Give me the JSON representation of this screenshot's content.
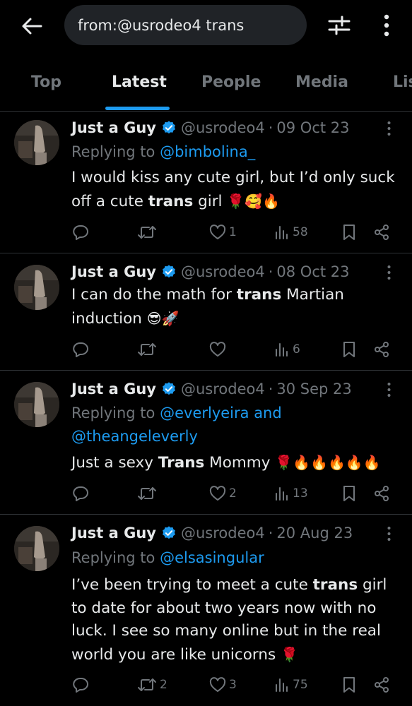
{
  "search": {
    "query": "from:@usrodeo4 trans"
  },
  "tabs": [
    "Top",
    "Latest",
    "People",
    "Media",
    "Lis"
  ],
  "accent": "#1d9bf0",
  "icons": {
    "back": "arrow-left-icon",
    "filter": "sliders-icon",
    "more": "more-vertical-icon",
    "reply": "reply-icon",
    "retweet": "retweet-icon",
    "like": "heart-icon",
    "views": "views-icon",
    "bookmark": "bookmark-icon",
    "share": "share-icon"
  },
  "tweets": [
    {
      "name": "Just a Guy",
      "handle": "@usrodeo4",
      "sep": "·",
      "date": "09 Oct 23",
      "replying_label": "Replying to",
      "replying_to": "@bimbolina_",
      "text_parts": [
        "I would kiss any cute girl, but I’d only suck off a cute ",
        "trans",
        " girl ",
        "🌹🥰🔥"
      ],
      "replies": "",
      "retweets": "",
      "likes": "1",
      "views": "58"
    },
    {
      "name": "Just a Guy",
      "handle": "@usrodeo4",
      "sep": "·",
      "date": "08 Oct 23",
      "text_parts": [
        "I can do the math for ",
        "trans",
        " Martian induction ",
        "😎🚀"
      ],
      "replies": "",
      "retweets": "",
      "likes": "",
      "views": "6"
    },
    {
      "name": "Just a Guy",
      "handle": "@usrodeo4",
      "sep": "·",
      "date": "30 Sep 23",
      "replying_label": "Replying to",
      "replying_to": "@everlyeira and",
      "replying_to_2": "@theangeleverly",
      "text_parts": [
        "Just a sexy ",
        "Trans",
        " Mommy ",
        "🌹🔥🔥🔥🔥🔥"
      ],
      "replies": "",
      "retweets": "",
      "likes": "2",
      "views": "13"
    },
    {
      "name": "Just a Guy",
      "handle": "@usrodeo4",
      "sep": "·",
      "date": "20 Aug 23",
      "replying_label": "Replying to",
      "replying_to": "@elsasingular",
      "text_parts": [
        "I’ve been trying to meet a cute ",
        "trans",
        " girl to date for about two years now with no luck. I see so many online but in the real world you are like unicorns ",
        "🌹"
      ],
      "replies": "",
      "retweets": "2",
      "likes": "3",
      "views": "75"
    }
  ]
}
